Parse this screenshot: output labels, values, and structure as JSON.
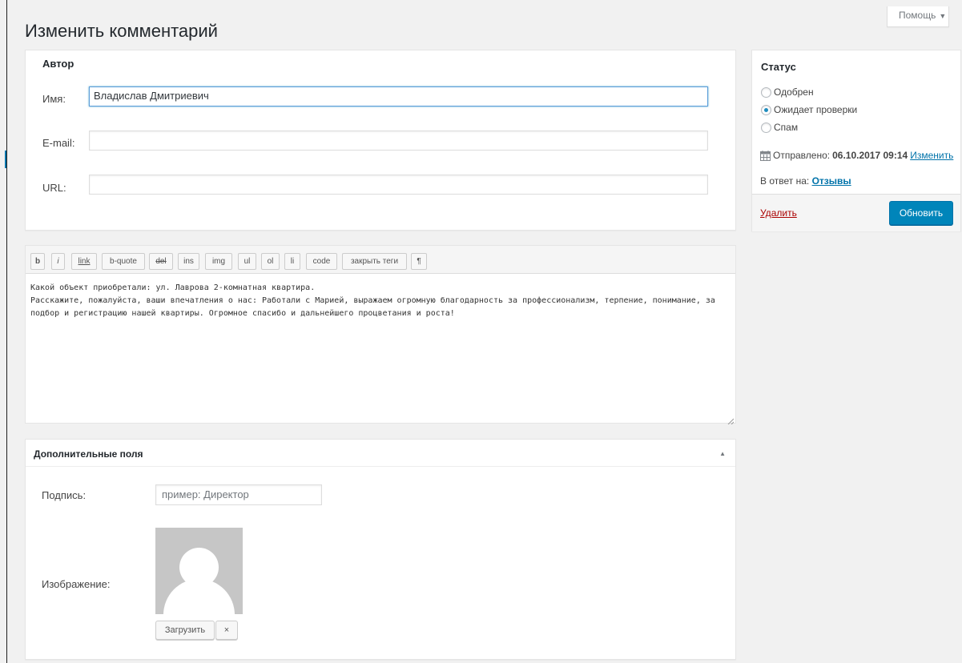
{
  "help": {
    "label": "Помощь",
    "arrow": "▼"
  },
  "page": {
    "title": "Изменить комментарий"
  },
  "author": {
    "title": "Автор",
    "name_label": "Имя:",
    "name_value": "Владислав Дмитриевич",
    "email_label": "E-mail:",
    "email_value": "",
    "url_label": "URL:",
    "url_value": ""
  },
  "status": {
    "title": "Статус",
    "options": [
      {
        "label": "Одобрен",
        "checked": false
      },
      {
        "label": "Ожидает проверки",
        "checked": true
      },
      {
        "label": "Спам",
        "checked": false
      }
    ],
    "sent_label": "Отправлено:",
    "sent_value": "06.10.2017 09:14",
    "edit_link": "Изменить",
    "reply_label": "В ответ на:",
    "reply_link": "Отзывы",
    "delete_link": "Удалить",
    "update_button": "Обновить",
    "update_color": "#0085ba"
  },
  "editor": {
    "buttons": [
      "b",
      "i",
      "link",
      "b-quote",
      "del",
      "ins",
      "img",
      "ul",
      "ol",
      "li",
      "code",
      "закрыть теги",
      "¶"
    ],
    "content": "Какой объект приобретали: ул. Лаврова 2-комнатная квартира.\nРасскажите, пожалуйста, ваши впечатления о нас: Работали с Марией, выражаем огромную благодарность за профессионализм, терпение, понимание, за подбор и регистрацию нашей квартиры. Огромное спасибо и дальнейшего процветания и роста!"
  },
  "extra": {
    "title": "Дополнительные поля",
    "toggle": "▲",
    "signature_label": "Подпись:",
    "signature_placeholder": "пример: Директор",
    "image_label": "Изображение:",
    "upload_button": "Загрузить",
    "remove_button": "×"
  }
}
